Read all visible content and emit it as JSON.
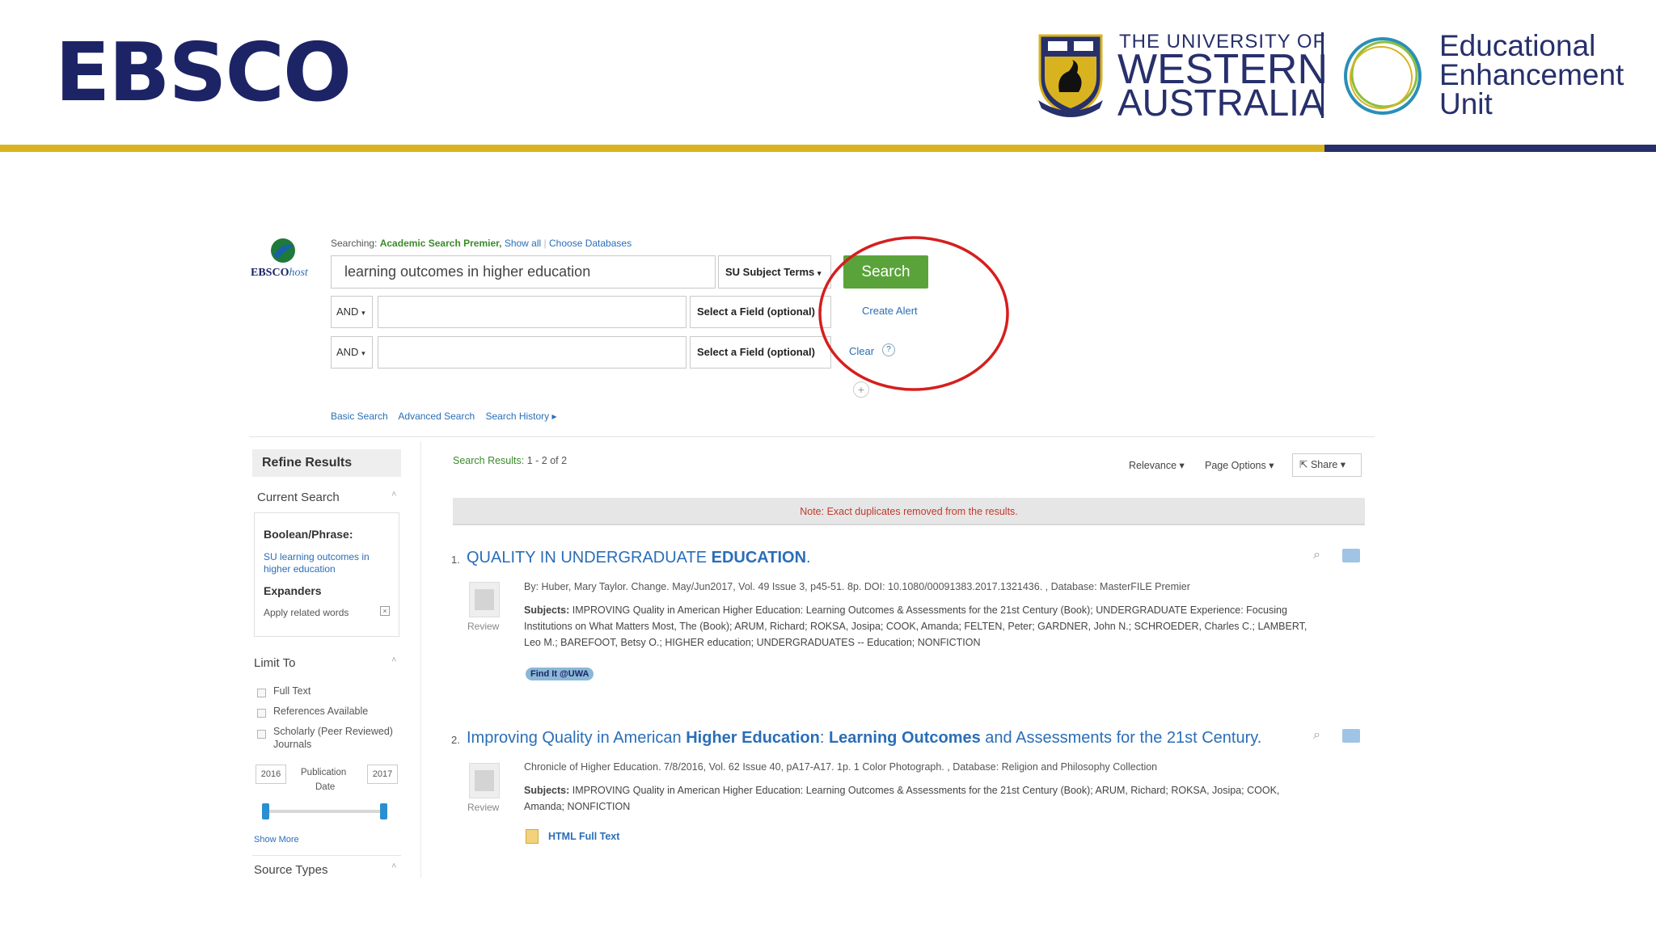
{
  "slide": {
    "title": "EBSCO",
    "uwa": {
      "line1": "THE UNIVERSITY OF",
      "line2": "WESTERN",
      "line3": "AUSTRALIA"
    },
    "eeu": {
      "line1": "Educational",
      "line2": "Enhancement",
      "line3": "Unit"
    },
    "colors": {
      "navy": "#27306b",
      "gold": "#d9b31f",
      "search_green": "#5aa33b",
      "highlight_red": "#d61e1e"
    }
  },
  "ebsco": {
    "logo_text": "EBSCO",
    "logo_suffix": "host",
    "searching_label": "Searching:",
    "database": "Academic Search Premier,",
    "show_all": "Show all",
    "choose_databases": "Choose Databases",
    "query": "learning outcomes in higher education",
    "field1": "SU Subject Terms",
    "and1": "AND",
    "and2": "AND",
    "field2": "Select a Field (optional)",
    "field3": "Select a Field (optional)",
    "search_button": "Search",
    "create_alert": "Create Alert",
    "clear": "Clear",
    "help": "?",
    "add_row": "+",
    "nav": {
      "basic": "Basic Search",
      "advanced": "Advanced Search",
      "history": "Search History ▸"
    }
  },
  "sidebar": {
    "refine": "Refine Results",
    "current_search": "Current Search",
    "boolean_heading": "Boolean/Phrase:",
    "boolean_value_1": "SU learning outcomes in",
    "boolean_value_2": "higher education",
    "expanders": "Expanders",
    "apply_related": "Apply related words",
    "limit_to": "Limit To",
    "full_text": "Full Text",
    "references": "References Available",
    "scholarly_1": "Scholarly (Peer Reviewed)",
    "scholarly_2": "Journals",
    "year_from": "2016",
    "year_to": "2017",
    "pub_date_1": "Publication",
    "pub_date_2": "Date",
    "show_more": "Show More",
    "source_types": "Source Types",
    "collapse_glyph": "˄"
  },
  "results": {
    "label": "Search Results:",
    "range": "1 - 2 of 2",
    "relevance": "Relevance ▾",
    "page_options": "Page Options ▾",
    "share": "Share ▾",
    "note": "Note: Exact duplicates removed from the results.",
    "review": "Review",
    "items": [
      {
        "num": "1.",
        "title_a": "QUALITY IN UNDERGRADUATE ",
        "title_b": "EDUCATION",
        "title_c": ".",
        "meta": "By: Huber, Mary Taylor. Change. May/Jun2017, Vol. 49 Issue 3, p45-51. 8p. DOI: 10.1080/00091383.2017.1321436. , Database: MasterFILE Premier",
        "subjects_label": "Subjects:",
        "subjects_1": "IMPROVING Quality in American Higher Education: Learning Outcomes & Assessments for the 21st Century (Book); UNDERGRADUATE Experience: Focusing",
        "subjects_2": "Institutions on What Matters Most, The (Book); ARUM, Richard; ROKSA, Josipa; COOK, Amanda; FELTEN, Peter; GARDNER, John N.; SCHROEDER, Charles C.; LAMBERT,",
        "subjects_3": "Leo M.; BAREFOOT, Betsy O.; HIGHER education; UNDERGRADUATES -- Education; NONFICTION",
        "find_it": "Find It @UWA"
      },
      {
        "num": "2.",
        "title_a": "Improving Quality in American ",
        "title_b": "Higher Education",
        "title_c": ": ",
        "title_d": "Learning Outcomes",
        "title_e": " and Assessments for the 21st Century.",
        "meta": "Chronicle of Higher Education. 7/8/2016, Vol. 62 Issue 40, pA17-A17. 1p. 1 Color Photograph. , Database: Religion and Philosophy Collection",
        "subjects_label": "Subjects:",
        "subjects_1": "IMPROVING Quality in American Higher Education: Learning Outcomes & Assessments for the 21st Century (Book); ARUM, Richard; ROKSA, Josipa; COOK,",
        "subjects_2": "Amanda; NONFICTION",
        "fulltext": "HTML Full Text"
      }
    ]
  }
}
